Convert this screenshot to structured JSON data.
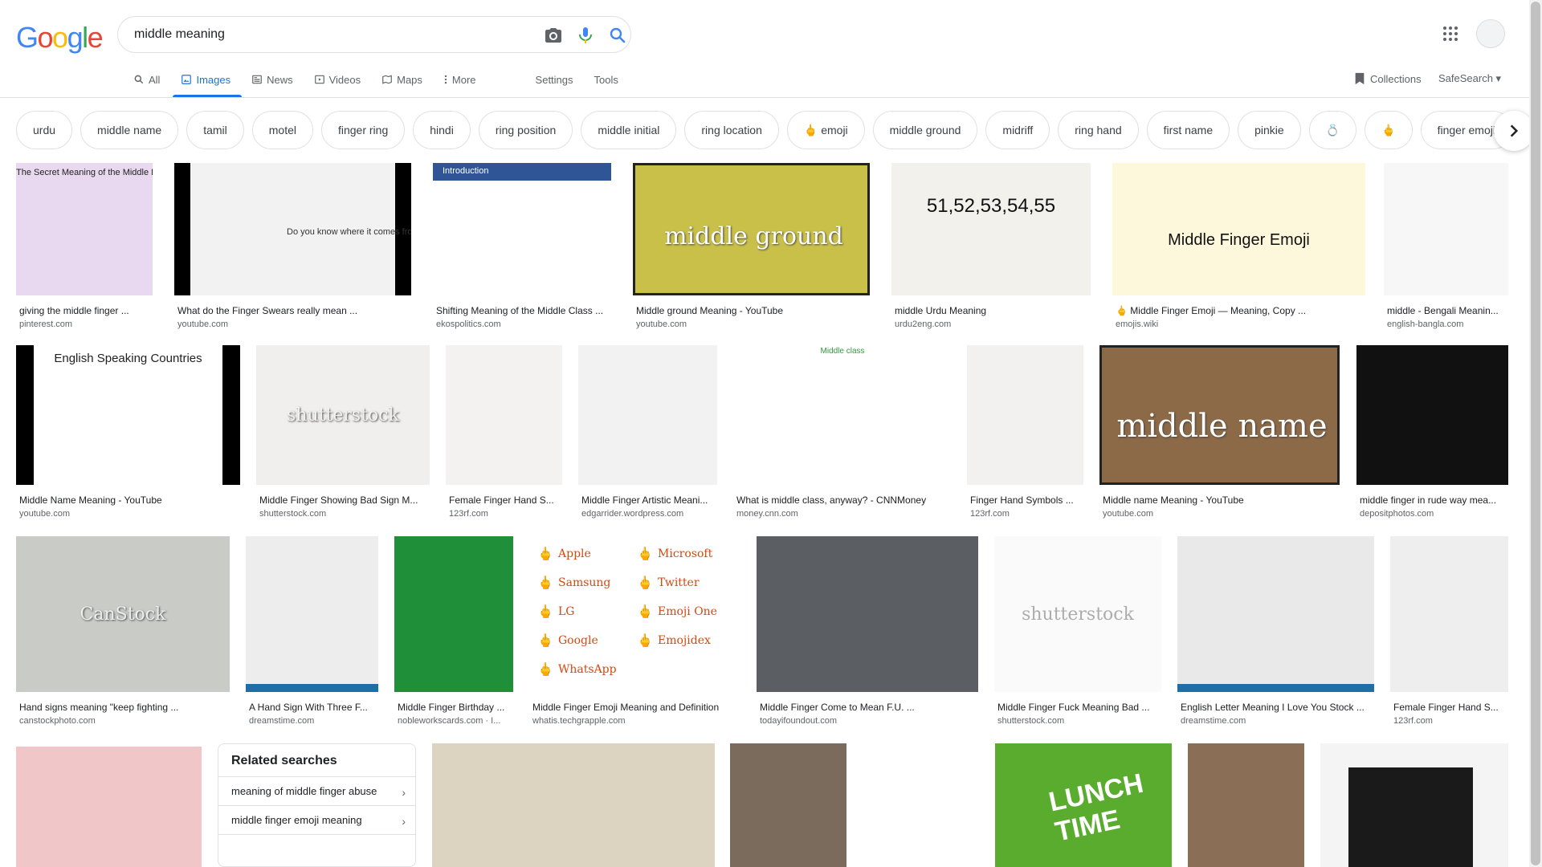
{
  "logo": {
    "letters": [
      "G",
      "o",
      "o",
      "g",
      "l",
      "e"
    ],
    "colors": [
      "#4285F4",
      "#EA4335",
      "#FBBC05",
      "#4285F4",
      "#34A853",
      "#EA4335"
    ]
  },
  "search": {
    "value": "middle meaning",
    "placeholder": "Search"
  },
  "tabs": [
    {
      "label": "All",
      "icon": "search-icon"
    },
    {
      "label": "Images",
      "icon": "image-icon",
      "active": true
    },
    {
      "label": "News",
      "icon": "news-icon"
    },
    {
      "label": "Videos",
      "icon": "video-icon"
    },
    {
      "label": "Maps",
      "icon": "map-icon"
    },
    {
      "label": "More",
      "icon": "more-vert-icon"
    },
    {
      "label": "Settings"
    },
    {
      "label": "Tools"
    }
  ],
  "right_tabs": {
    "collections": "Collections",
    "safesearch": "SafeSearch"
  },
  "chips": [
    "urdu",
    "middle name",
    "tamil",
    "motel",
    "finger ring",
    "hindi",
    "ring position",
    "middle initial",
    "ring location",
    "🖕 emoji",
    "middle ground",
    "midriff",
    "ring hand",
    "first name",
    "pinkie",
    "💍",
    "🖕",
    "finger emoji"
  ],
  "results": [
    {
      "caption": "giving the middle finger ...",
      "source": "pinterest.com",
      "overlay": "The Secret Meaning of the Middle Finger",
      "bg": "#e8d9f0"
    },
    {
      "caption": "What do the Finger Swears really mean ...",
      "source": "youtube.com",
      "overlay": "Do you know where it comes from?",
      "bg": "#f2f2f2"
    },
    {
      "caption": "Shifting Meaning of the Middle Class ...",
      "source": "ekospolitics.com",
      "overlay": "Introduction",
      "bg": "#ffffff"
    },
    {
      "caption": "Middle ground Meaning - YouTube",
      "source": "youtube.com",
      "overlay": "middle ground",
      "bg": "#c9c04a"
    },
    {
      "caption": "middle Urdu Meaning",
      "source": "urdu2eng.com",
      "overlay": "51,52,53,54,55",
      "bg": "#f3f1ec"
    },
    {
      "caption": "🖕 Middle Finger Emoji — Meaning, Copy ...",
      "source": "emojis.wiki",
      "overlay": "Middle Finger Emoji",
      "bg": "#fdf8dc"
    },
    {
      "caption": "middle - Bengali Meanin...",
      "source": "english-bangla.com",
      "overlay": "",
      "bg": "#f7f7f7"
    },
    {
      "caption": "Middle Name Meaning - YouTube",
      "source": "youtube.com",
      "overlay": "English Speaking Countries",
      "bg": "#ffffff"
    },
    {
      "caption": "Middle Finger Showing Bad Sign M...",
      "source": "shutterstock.com",
      "overlay": "shutterstock",
      "bg": "#f0efed"
    },
    {
      "caption": "Female Finger Hand S...",
      "source": "123rf.com",
      "overlay": "",
      "bg": "#f4f2f0"
    },
    {
      "caption": "Middle Finger Artistic Meani...",
      "source": "edgarrider.wordpress.com",
      "overlay": "",
      "bg": "#f2f2f2"
    },
    {
      "caption": "What is middle class, anyway? - CNNMoney",
      "source": "money.cnn.com",
      "overlay": "Middle class",
      "bg": "#ffffff"
    },
    {
      "caption": "Finger Hand Symbols ...",
      "source": "123rf.com",
      "overlay": "",
      "bg": "#f2f1f0"
    },
    {
      "caption": "Middle name Meaning - YouTube",
      "source": "youtube.com",
      "overlay": "middle name",
      "bg": "#8d6a47"
    },
    {
      "caption": "middle finger in rude way mea...",
      "source": "depositphotos.com",
      "overlay": "",
      "bg": "#141414"
    },
    {
      "caption": "Hand signs meaning \"keep fighting ...",
      "source": "canstockphoto.com",
      "overlay": "CanStock",
      "bg": "#c9cbc6"
    },
    {
      "caption": "A Hand Sign With Three F...",
      "source": "dreamstime.com",
      "overlay": "",
      "bg": "#ededed"
    },
    {
      "caption": "Middle Finger Birthday ...",
      "source": "nobleworkscards.com · I...",
      "overlay": "",
      "bg": "#1f8f3a"
    },
    {
      "caption": "Middle Finger Emoji Meaning and Definition",
      "source": "whatis.techgrapple.com",
      "overlay": "",
      "bg": "#ffffff"
    },
    {
      "caption": "Middle Finger Come to Mean F.U. ...",
      "source": "todayifoundout.com",
      "overlay": "",
      "bg": "#5b5e63"
    },
    {
      "caption": "Middle Finger Fuck Meaning Bad ...",
      "source": "shutterstock.com",
      "overlay": "shutterstock",
      "bg": "#fafafa"
    },
    {
      "caption": "English Letter Meaning I Love You Stock ...",
      "source": "dreamstime.com",
      "overlay": "",
      "bg": "#e9e9ea"
    },
    {
      "caption": "Female Finger Hand S...",
      "source": "123rf.com",
      "overlay": "",
      "bg": "#eeeeee"
    }
  ],
  "emoji_list": {
    "left": [
      "Apple",
      "Samsung",
      "LG",
      "Google",
      "WhatsApp"
    ],
    "right": [
      "Microsoft",
      "Twitter",
      "Emoji One",
      "Emojidex"
    ]
  },
  "related": {
    "title": "Related searches",
    "items": [
      "meaning of middle finger abuse",
      "middle finger emoji meaning"
    ]
  },
  "bottom_overlays": {
    "lunch": "LUNCH TIME"
  }
}
